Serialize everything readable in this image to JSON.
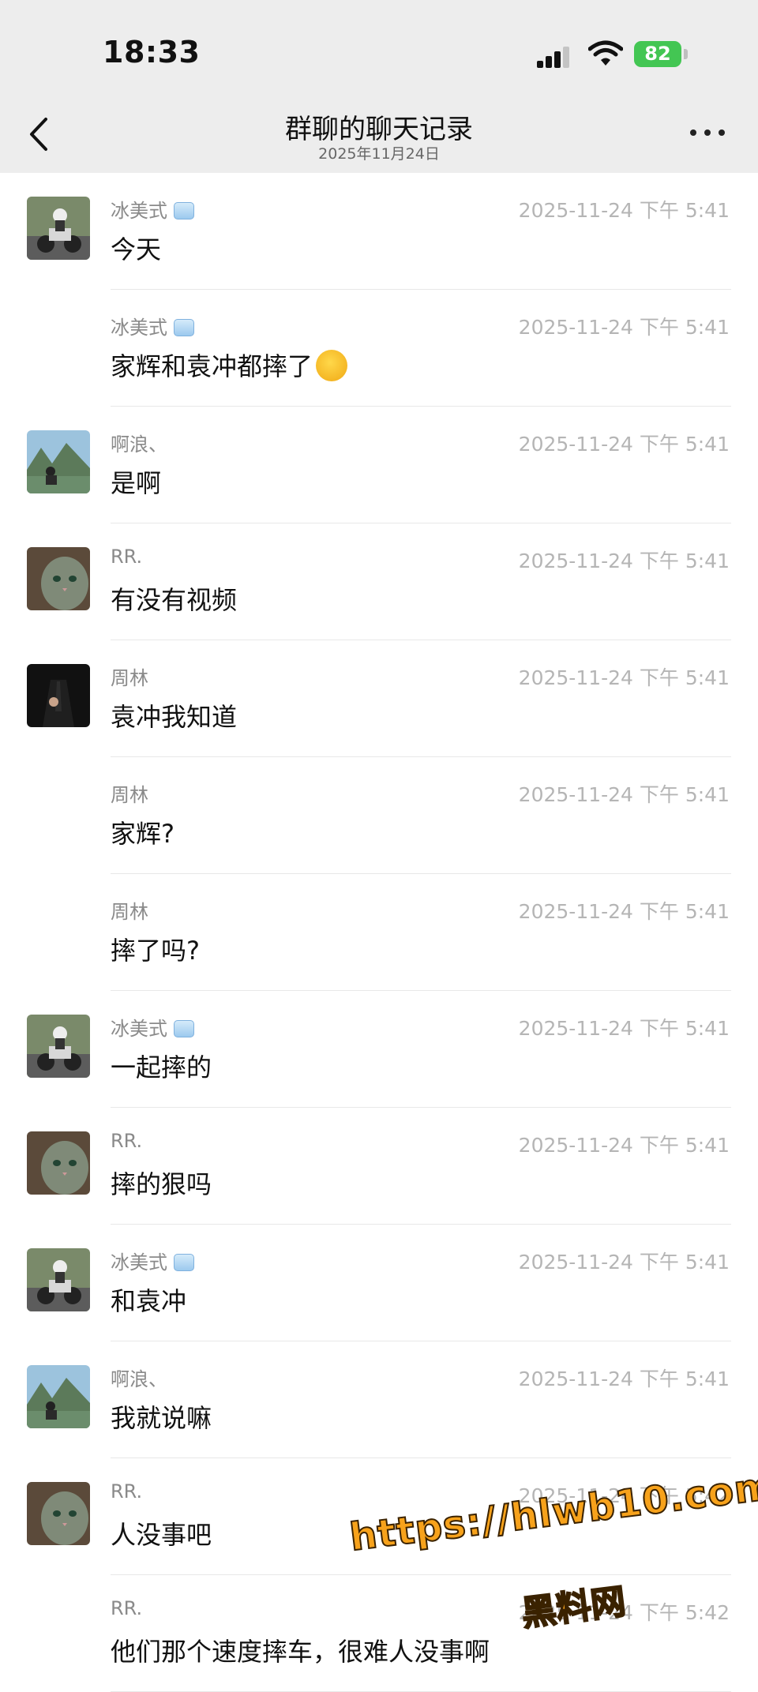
{
  "status_bar": {
    "time": "18:33",
    "battery": "82"
  },
  "nav": {
    "title": "群聊的聊天记录",
    "subtitle": "2025年11月24日"
  },
  "messages": [
    {
      "sender": "冰美式",
      "time": "2025-11-24 下午 5:41",
      "text": "今天",
      "avatar": "moto"
    },
    {
      "sender": "冰美式",
      "time": "2025-11-24 下午 5:41",
      "text": "家辉和袁冲都摔了",
      "avatar": ""
    },
    {
      "sender": "啊浪、",
      "time": "2025-11-24 下午 5:41",
      "text": "是啊",
      "avatar": "landscape"
    },
    {
      "sender": "RR.",
      "time": "2025-11-24 下午 5:41",
      "text": "有没有视频",
      "avatar": "cat"
    },
    {
      "sender": "周林",
      "time": "2025-11-24 下午 5:41",
      "text": "袁冲我知道",
      "avatar": "suit"
    },
    {
      "sender": "周林",
      "time": "2025-11-24 下午 5:41",
      "text": "家辉?",
      "avatar": ""
    },
    {
      "sender": "周林",
      "time": "2025-11-24 下午 5:41",
      "text": "摔了吗?",
      "avatar": ""
    },
    {
      "sender": "冰美式",
      "time": "2025-11-24 下午 5:41",
      "text": "一起摔的",
      "avatar": "moto"
    },
    {
      "sender": "RR.",
      "time": "2025-11-24 下午 5:41",
      "text": "摔的狠吗",
      "avatar": "cat"
    },
    {
      "sender": "冰美式",
      "time": "2025-11-24 下午 5:41",
      "text": "和袁冲",
      "avatar": "moto"
    },
    {
      "sender": "啊浪、",
      "time": "2025-11-24 下午 5:41",
      "text": "我就说嘛",
      "avatar": "landscape"
    },
    {
      "sender": "RR.",
      "time": "2025-11-24 下午 5:42",
      "text": "人没事吧",
      "avatar": "cat"
    },
    {
      "sender": "RR.",
      "time": "2025-11-24 下午 5:42",
      "text": "他们那个速度摔车，很难人没事啊",
      "avatar": ""
    }
  ],
  "watermark": {
    "url": "https://hlwb10.com",
    "label": "黑料网"
  }
}
